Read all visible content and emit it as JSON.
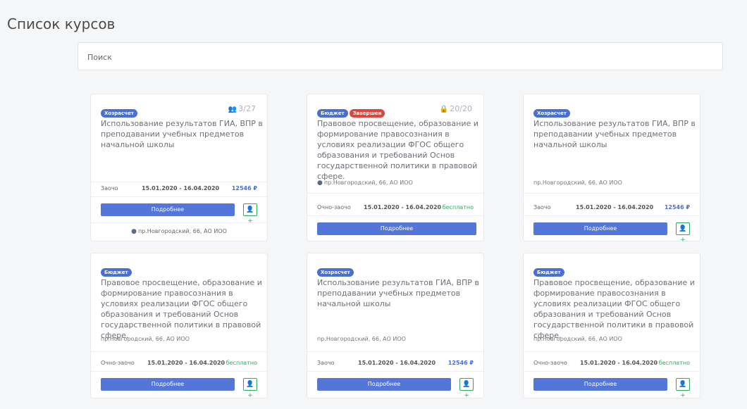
{
  "page": {
    "title": "Список курсов"
  },
  "search": {
    "placeholder": "Поиск"
  },
  "labels": {
    "more": "Подробнее",
    "add_icon": "user-plus-icon",
    "pin_icon": "map-pin-icon"
  },
  "cards": [
    {
      "badges": [
        {
          "text": "Хозрасчет",
          "color": "#4a6fd1"
        }
      ],
      "counter": {
        "icon": "users-icon",
        "text": "3/27"
      },
      "title": "Использование результатов ГИА, ВПР в преподавании учебных предметов начальной школы",
      "form": "Заочо",
      "dates": "15.01.2020 - 16.04.2020",
      "price": "12546 ₽",
      "address": "пр.Новгородский, 66, АО ИОО"
    },
    {
      "badges": [
        {
          "text": "Бюджет",
          "color": "#4a6fd1"
        },
        {
          "text": "Завершен",
          "color": "#e0443b"
        }
      ],
      "counter": {
        "icon": "lock-icon",
        "text": "20/20"
      },
      "title": "Правовое просвещение, образование и формирование правосознания в условиях реализации ФГОС общего образования и требований Основ государственной политики в правовой сфере.",
      "address": "пр.Новгородский, 66, АО ИОО",
      "form": "Очно-заочо",
      "dates": "15.01.2020 - 16.04.2020",
      "price": "бесплатно"
    },
    {
      "badges": [
        {
          "text": "Хозрасчет",
          "color": "#4a6fd1"
        }
      ],
      "title": "Использование результатов ГИА, ВПР в преподавании учебных предметов начальной школы",
      "address": "пр.Новгородский, 66, АО ИОО",
      "form": "Заочо",
      "dates": "15.01.2020 - 16.04.2020",
      "price": "12546 ₽"
    },
    {
      "badges": [
        {
          "text": "Бюджет",
          "color": "#4a6fd1"
        }
      ],
      "title": "Правовое просвещение, образование и формирование правосознания в условиях реализации ФГОС общего образования и требований Основ государственной политики в правовой сфере.",
      "address": "пр.Новгородский, 66, АО ИОО",
      "form": "Очно-заочо",
      "dates": "15.01.2020 - 16.04.2020",
      "price": "бесплатно"
    },
    {
      "badges": [
        {
          "text": "Хозрасчет",
          "color": "#4a6fd1"
        }
      ],
      "title": "Использование результатов ГИА, ВПР в преподавании учебных предметов начальной школы",
      "address": "пр.Новгородский, 66, АО ИОО",
      "form": "Заочо",
      "dates": "15.01.2020 - 16.04.2020",
      "price": "12546 ₽"
    },
    {
      "badges": [
        {
          "text": "Бюджет",
          "color": "#4a6fd1"
        }
      ],
      "title": "Правовое просвещение, образование и формирование правосознания в условиях реализации ФГОС общего образования и требований Основ государственной политики в правовой сфере.",
      "address": "пр.Новгородский, 66, АО ИОО",
      "form": "Очно-заочо",
      "dates": "15.01.2020 - 16.04.2020",
      "price": "бесплатно"
    }
  ]
}
